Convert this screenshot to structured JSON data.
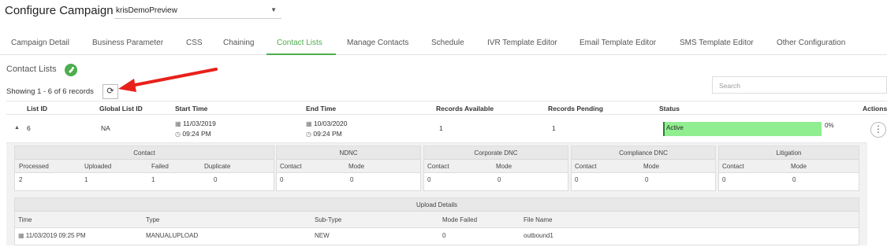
{
  "header": {
    "title": "Configure Campaign",
    "campaign": "krisDemoPreview"
  },
  "tabs": [
    {
      "label": "Campaign Detail"
    },
    {
      "label": "Business Parameter"
    },
    {
      "label": "CSS"
    },
    {
      "label": "Chaining"
    },
    {
      "label": "Contact Lists"
    },
    {
      "label": "Manage Contacts"
    },
    {
      "label": "Schedule"
    },
    {
      "label": "IVR Template Editor"
    },
    {
      "label": "Email Template Editor"
    },
    {
      "label": "SMS Template Editor"
    },
    {
      "label": "Other Configuration"
    }
  ],
  "active_tab": "Contact Lists",
  "section": {
    "title": "Contact Lists",
    "showing": "Showing 1 - 6 of 6 records",
    "search_placeholder": "Search"
  },
  "table": {
    "columns": [
      "List ID",
      "Global List ID",
      "Start Time",
      "End Time",
      "Records Available",
      "Records Pending",
      "Status",
      "Actions"
    ],
    "row": {
      "list_id": "6",
      "global_list_id": "NA",
      "start_date": "11/03/2019",
      "start_time": "09:24 PM",
      "end_date": "10/03/2020",
      "end_time": "09:24 PM",
      "records_available": "1",
      "records_pending": "1",
      "status": "Active",
      "progress_text": "0%",
      "progress": 0
    }
  },
  "details": {
    "contact": {
      "title": "Contact",
      "columns": [
        "Processed",
        "Uploaded",
        "Failed",
        "Duplicate"
      ],
      "values": [
        "2",
        "1",
        "1",
        "0"
      ]
    },
    "ndnc": {
      "title": "NDNC",
      "columns": [
        "Contact",
        "Mode"
      ],
      "values": [
        "0",
        "0"
      ]
    },
    "corporate_dnc": {
      "title": "Corporate DNC",
      "columns": [
        "Contact",
        "Mode"
      ],
      "values": [
        "0",
        "0"
      ]
    },
    "compliance_dnc": {
      "title": "Compliance DNC",
      "columns": [
        "Contact",
        "Mode"
      ],
      "values": [
        "0",
        "0"
      ]
    },
    "litigation": {
      "title": "Litigation",
      "columns": [
        "Contact",
        "Mode"
      ],
      "values": [
        "0",
        "0"
      ]
    },
    "upload": {
      "title": "Upload Details",
      "columns": [
        "Time",
        "Type",
        "Sub-Type",
        "Mode Failed",
        "File Name"
      ],
      "values": [
        "11/03/2019 09:25 PM",
        "MANUALUPLOAD",
        "NEW",
        "0",
        "outbound1"
      ]
    }
  },
  "colors": {
    "accent": "#4cae4c",
    "status_fill": "#90ee90",
    "arrow": "#e8211b"
  },
  "icons": [
    "add-list-icon",
    "refresh-icon",
    "calendar-icon",
    "clock-icon",
    "expand-caret-icon",
    "kebab-menu-icon",
    "chevron-down-icon"
  ]
}
